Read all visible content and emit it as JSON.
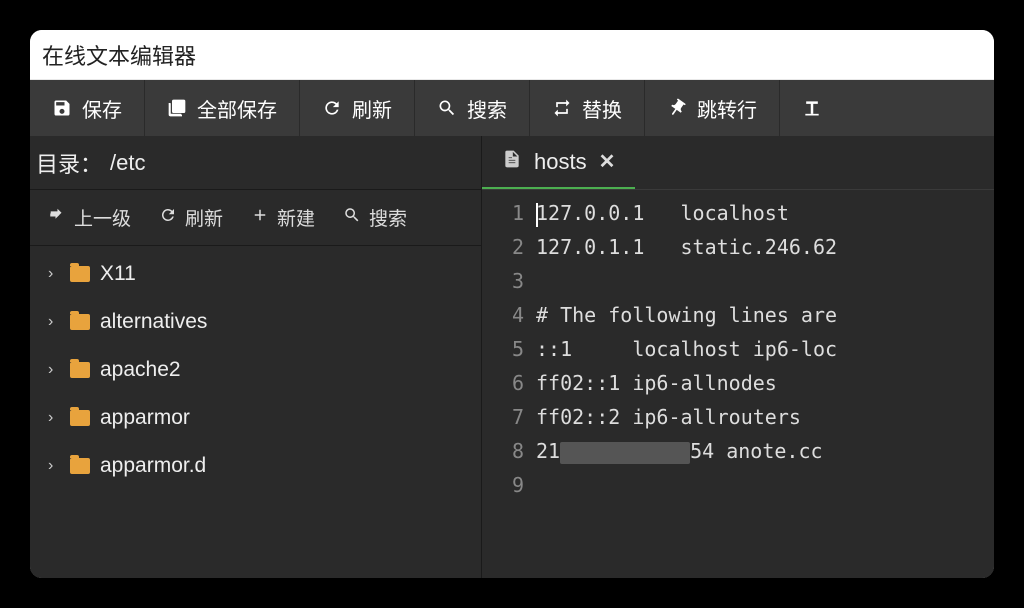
{
  "title": "在线文本编辑器",
  "toolbar": {
    "save": "保存",
    "save_all": "全部保存",
    "refresh": "刷新",
    "search": "搜索",
    "replace": "替换",
    "goto": "跳转行"
  },
  "sidebar": {
    "dir_label": "目录：",
    "dir_path": "/etc",
    "up": "上一级",
    "refresh": "刷新",
    "new": "新建",
    "search": "搜索",
    "items": [
      {
        "name": "X11"
      },
      {
        "name": "alternatives"
      },
      {
        "name": "apache2"
      },
      {
        "name": "apparmor"
      },
      {
        "name": "apparmor.d"
      }
    ]
  },
  "editor": {
    "tab_name": "hosts",
    "lines": [
      "127.0.0.1   localhost",
      "127.0.1.1   static.246.62",
      "",
      "# The following lines are",
      "::1     localhost ip6-loc",
      "ff02::1 ip6-allnodes",
      "ff02::2 ip6-allrouters",
      "21██████████54 anote.cc",
      ""
    ],
    "line_numbers": [
      "1",
      "2",
      "3",
      "4",
      "5",
      "6",
      "7",
      "8",
      "9"
    ]
  }
}
